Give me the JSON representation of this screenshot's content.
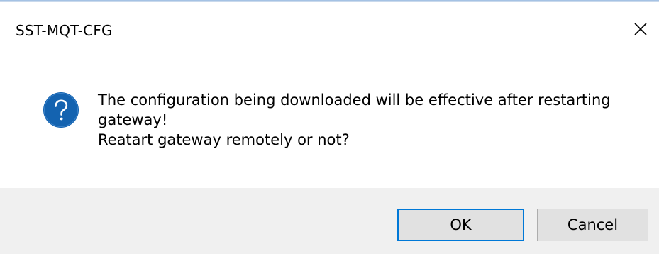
{
  "window": {
    "title": "SST-MQT-CFG"
  },
  "icons": {
    "question": "question-icon",
    "close": "close-icon"
  },
  "message": {
    "line1": "The configuration being downloaded will be effective after restarting",
    "line2": "gateway!",
    "line3": "Reatart gateway remotely or not?"
  },
  "buttons": {
    "ok_label": "OK",
    "cancel_label": "Cancel"
  },
  "colors": {
    "accent": "#0078d7",
    "icon_blue": "#1463b0",
    "footer_bg": "#f0f0f0"
  }
}
